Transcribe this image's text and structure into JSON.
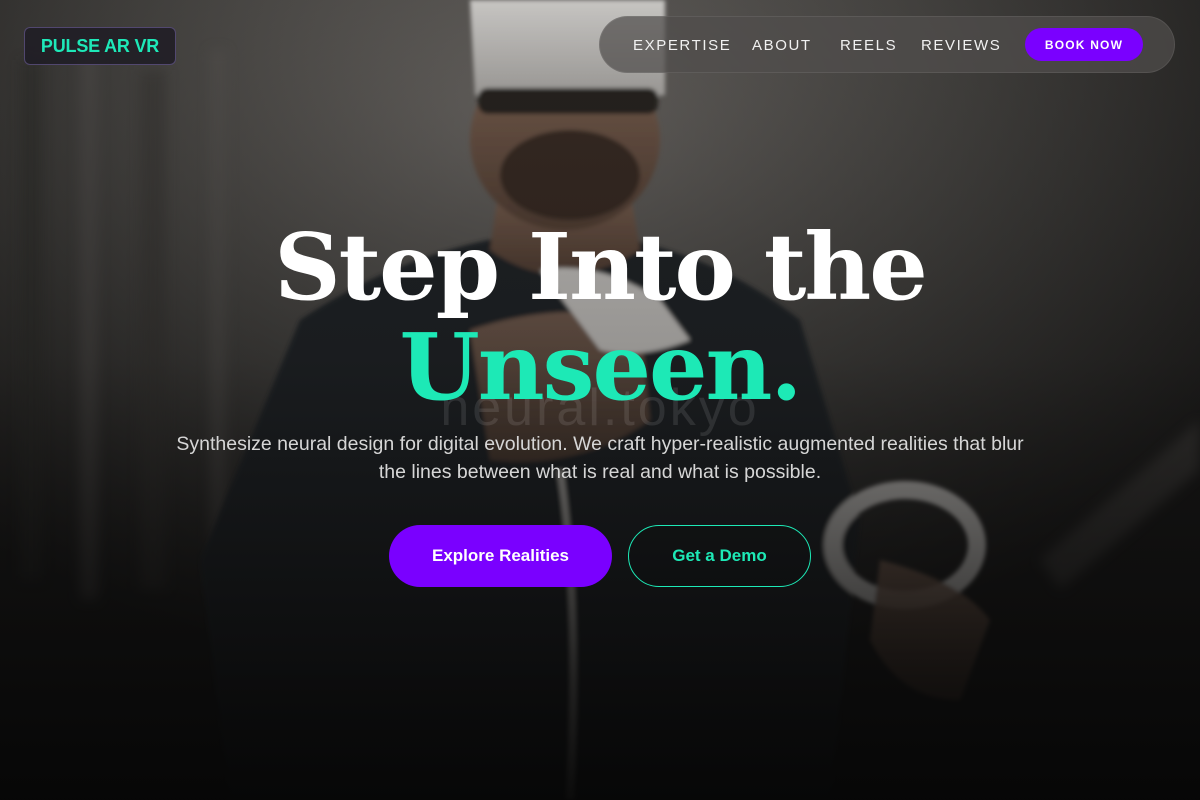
{
  "brand": {
    "logo_text": "PULSE AR VR"
  },
  "nav": {
    "links": [
      "EXPERTISE",
      "ABOUT",
      "REELS",
      "REVIEWS"
    ],
    "cta": "BOOK NOW"
  },
  "hero": {
    "title_line1": "Step Into the",
    "title_line2": "Unseen.",
    "watermark": "neural.tokyo",
    "subtitle": "Synthesize neural design for digital evolution. We craft hyper-realistic augmented realities that blur the lines between what is real and what is possible.",
    "primary_cta": "Explore Realities",
    "secondary_cta": "Get a Demo"
  },
  "colors": {
    "accent_teal": "#1de9b6",
    "accent_purple": "#7a00ff",
    "nav_background": "#504e4c"
  }
}
